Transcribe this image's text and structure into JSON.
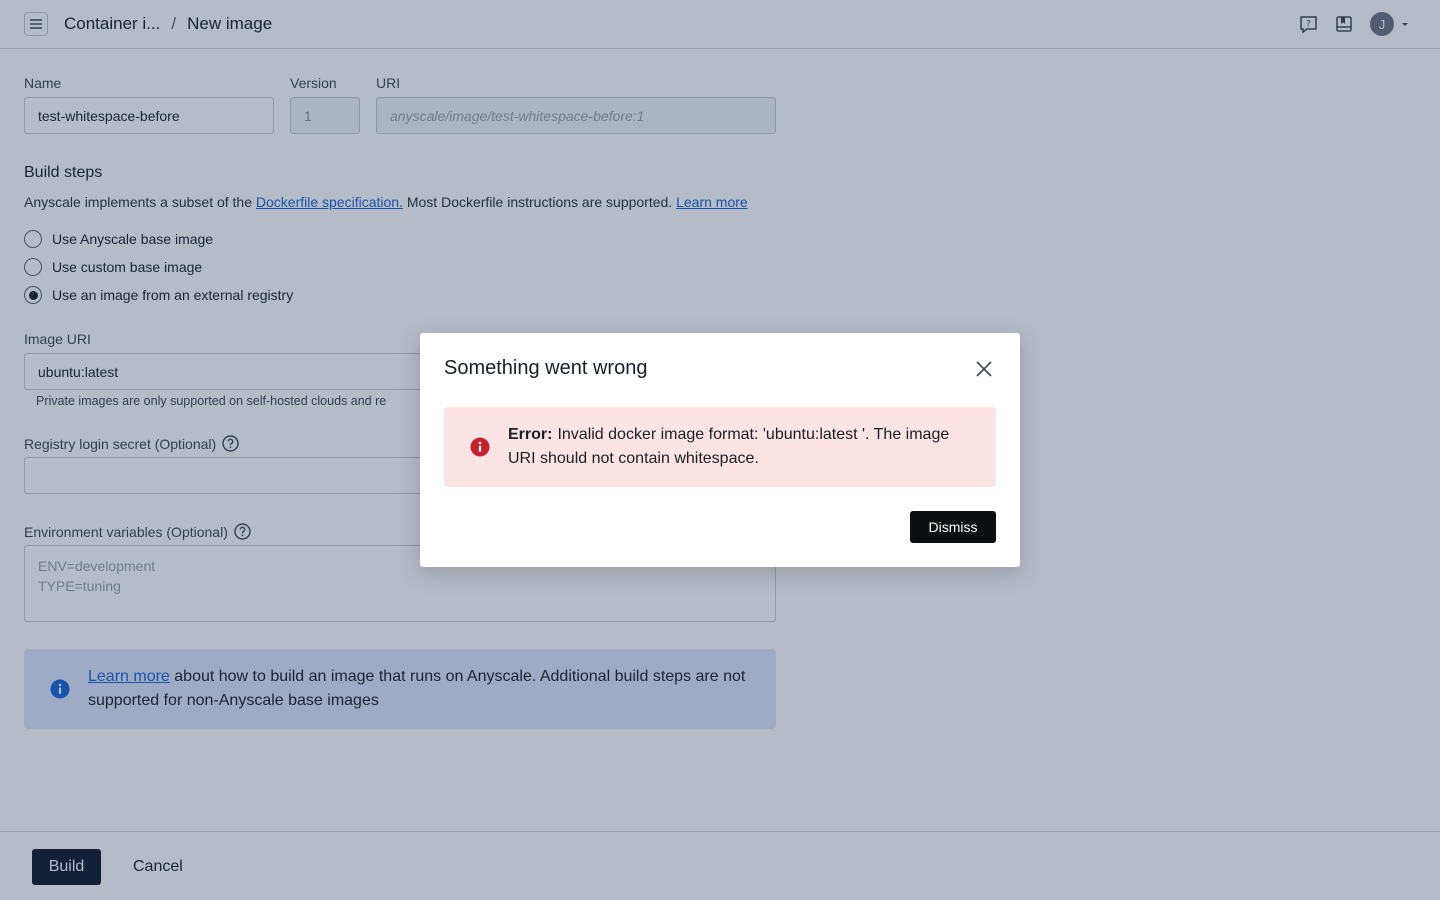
{
  "header": {
    "breadcrumb": [
      {
        "label": "Container i..."
      },
      {
        "label": "New image"
      }
    ],
    "separator": "/",
    "avatar_initial": "J",
    "icons": [
      "menu-icon",
      "help-icon",
      "docs-icon",
      "chevron-down-icon"
    ]
  },
  "form": {
    "name": {
      "label": "Name",
      "value": "test-whitespace-before"
    },
    "version": {
      "label": "Version",
      "value": "1"
    },
    "uri": {
      "label": "URI",
      "placeholder": "anyscale/image/test-whitespace-before:1"
    },
    "build_steps": {
      "title": "Build steps",
      "desc_prefix": "Anyscale implements a subset of the ",
      "desc_link1": "Dockerfile specification.",
      "desc_middle": " Most Dockerfile instructions are supported. ",
      "desc_link2": "Learn more",
      "options": [
        {
          "label": "Use Anyscale base image",
          "checked": false
        },
        {
          "label": "Use custom base image",
          "checked": false
        },
        {
          "label": "Use an image from an external registry",
          "checked": true
        }
      ]
    },
    "image_uri": {
      "label": "Image URI",
      "value": "ubuntu:latest",
      "helper": "Private images are only supported on self-hosted clouds and re"
    },
    "registry_secret": {
      "label": "Registry login secret (Optional)",
      "value": ""
    },
    "env_vars": {
      "label": "Environment variables (Optional)",
      "placeholder_line1": "ENV=development",
      "placeholder_line2": "TYPE=tuning"
    },
    "info": {
      "link": "Learn more",
      "text": " about how to build an image that runs on Anyscale. Additional build steps are not supported for non-Anyscale base images"
    }
  },
  "footer": {
    "build_label": "Build",
    "cancel_label": "Cancel"
  },
  "modal": {
    "title": "Something went wrong",
    "error_label": "Error:",
    "error_message": "Invalid docker image format: 'ubuntu:latest '. The image URI should not contain whitespace.",
    "dismiss_label": "Dismiss"
  },
  "colors": {
    "primary": "#0c1a2b",
    "link": "#1565d8",
    "error": "#c8202a",
    "error_bg": "#fce4e4",
    "info": "#1565d8",
    "info_bg": "#dce8fb"
  }
}
